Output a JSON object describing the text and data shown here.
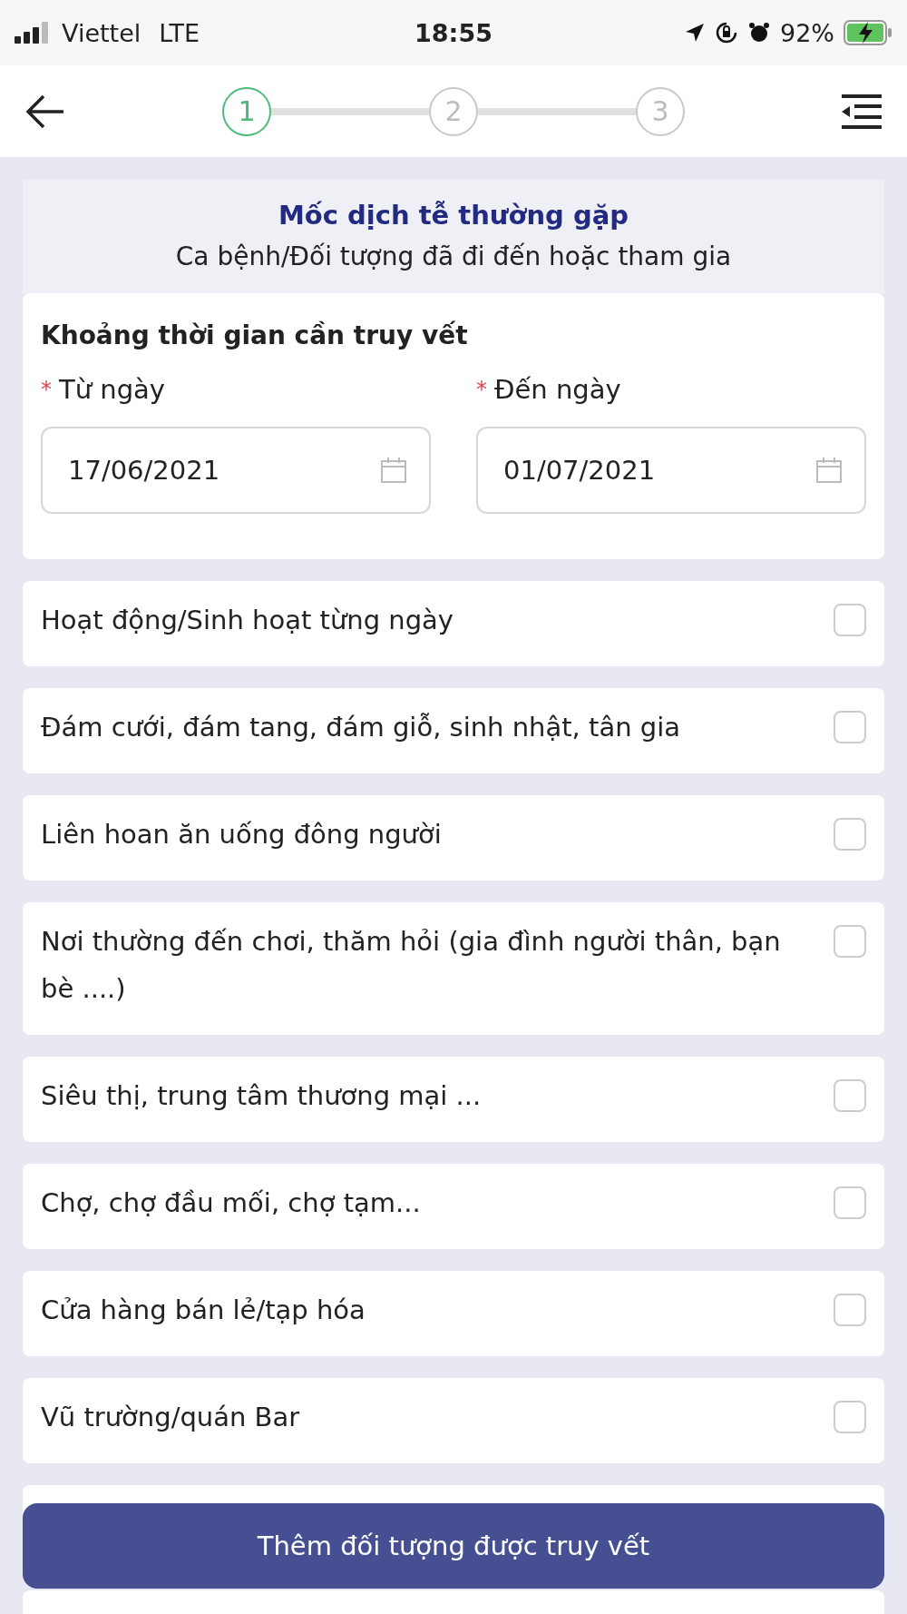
{
  "status_bar": {
    "carrier": "Viettel",
    "network": "LTE",
    "time": "18:55",
    "battery": "92%"
  },
  "stepper": {
    "steps": [
      {
        "label": "1",
        "selected": true
      },
      {
        "label": "2",
        "selected": false
      },
      {
        "label": "3",
        "selected": false
      }
    ]
  },
  "section": {
    "title": "Mốc dịch tễ thường gặp",
    "subtitle": "Ca bệnh/Đối tượng đã đi đến hoặc tham gia"
  },
  "date_range": {
    "title": "Khoảng thời gian cần truy vết",
    "fields": [
      {
        "required": "*",
        "label": "Từ ngày",
        "value": "17/06/2021"
      },
      {
        "required": "*",
        "label": "Đến ngày",
        "value": "01/07/2021"
      }
    ]
  },
  "items": [
    {
      "label": "Hoạt động/Sinh hoạt từng ngày",
      "checked": false
    },
    {
      "label": "Đám cưới, đám tang, đám giỗ, sinh nhật, tân gia",
      "checked": false
    },
    {
      "label": "Liên hoan ăn uống đông người",
      "checked": false
    },
    {
      "label": "Nơi thường đến chơi, thăm hỏi (gia đình người thân, bạn bè ....)",
      "checked": false
    },
    {
      "label": "Siêu thị, trung tâm thương mại ...",
      "checked": false
    },
    {
      "label": "Chợ, chợ đầu mối, chợ tạm...",
      "checked": false
    },
    {
      "label": "Cửa hàng bán lẻ/tạp hóa",
      "checked": false
    },
    {
      "label": "Vũ trường/quán Bar",
      "checked": false
    }
  ],
  "add_button": "Thêm đối tượng được truy vết"
}
